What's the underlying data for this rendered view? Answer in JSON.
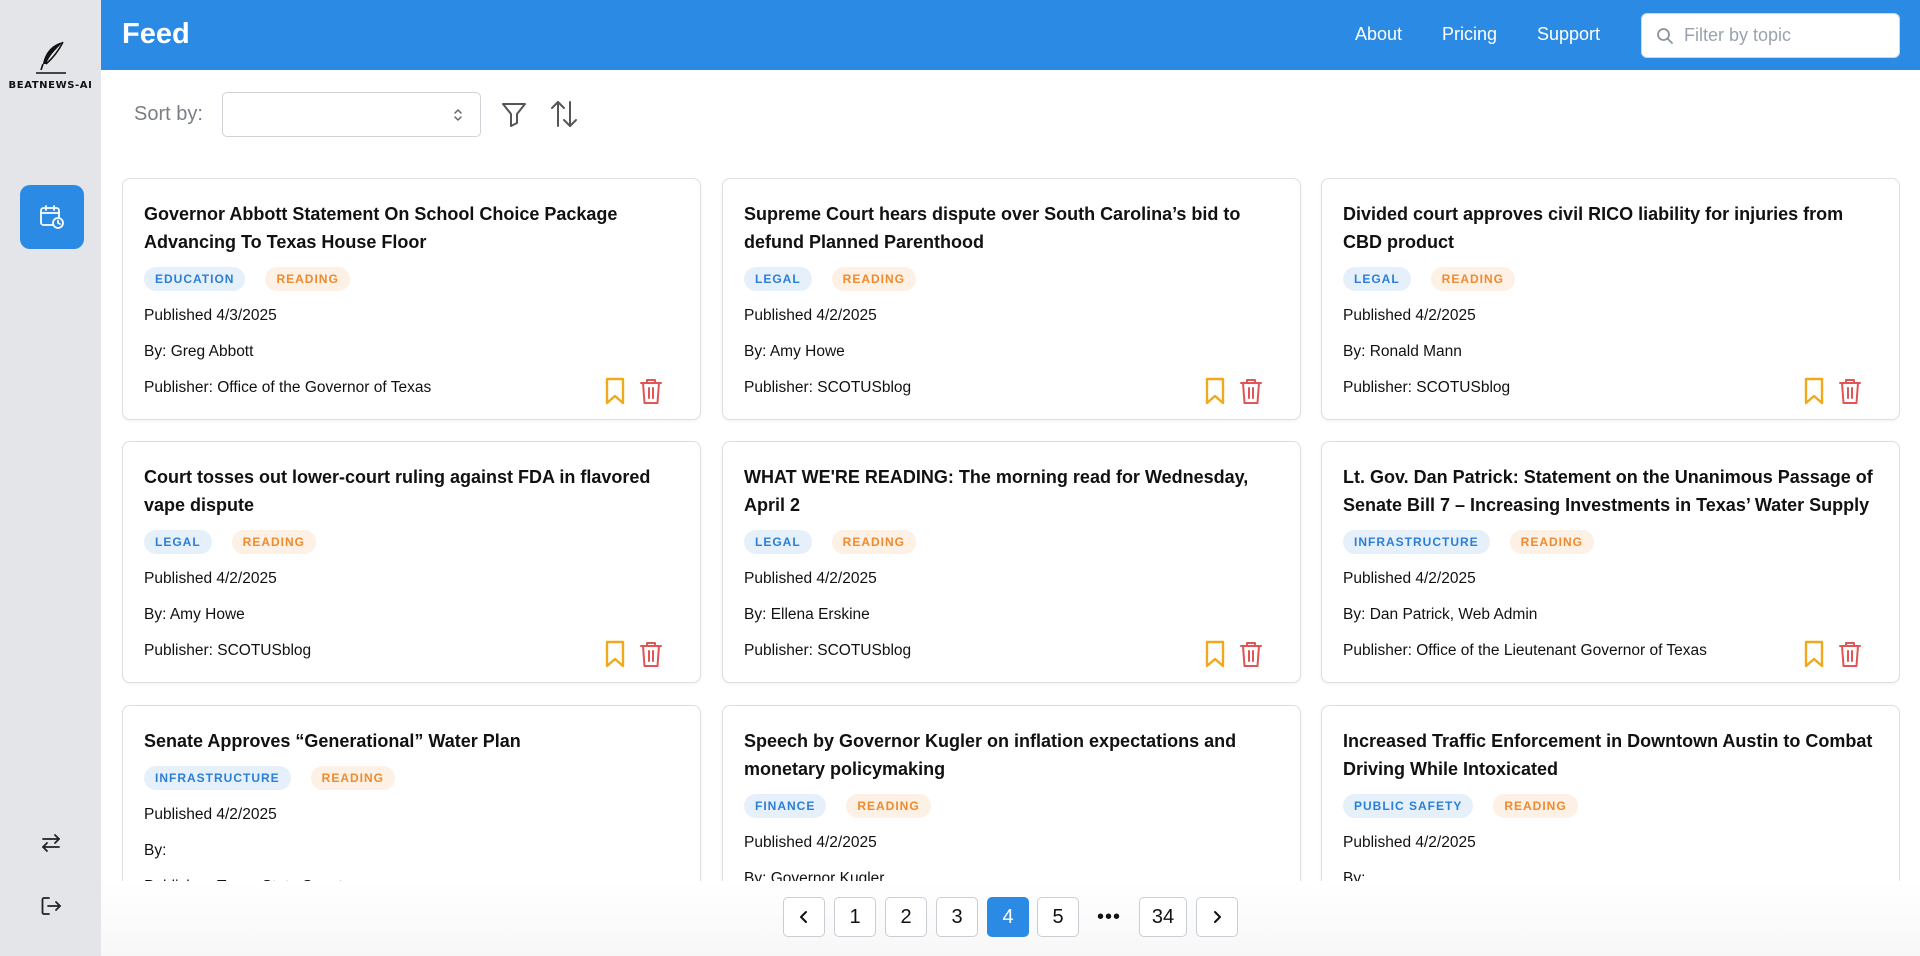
{
  "app": {
    "logo_text": "BEATNEWS-AI",
    "title": "Feed"
  },
  "nav": [
    {
      "label": "About"
    },
    {
      "label": "Pricing"
    },
    {
      "label": "Support"
    }
  ],
  "search": {
    "placeholder": "Filter by topic",
    "value": ""
  },
  "toolbar": {
    "sort_label": "Sort by:",
    "sort_value": ""
  },
  "colors": {
    "accent": "#2b8ae3",
    "bookmark": "#f0a91c",
    "delete": "#e05555",
    "tag_category": "#2b7fd4",
    "tag_reading": "#ef8a2e"
  },
  "icons": {
    "logo": "quill-icon",
    "sidebar_feed": "calendar-clock-icon",
    "sidebar_switch": "swap-arrows-icon",
    "sidebar_logout": "logout-icon",
    "search": "search-icon",
    "filter": "filter-icon",
    "sort": "sort-arrows-icon",
    "bookmark": "bookmark-icon",
    "delete": "trash-icon"
  },
  "cards": [
    {
      "title": "Governor Abbott Statement On School Choice Package Advancing To Texas House Floor",
      "category": "EDUCATION",
      "status": "READING",
      "published": "Published 4/3/2025",
      "by": "By: Greg Abbott",
      "publisher": "Publisher: Office of the Governor of Texas"
    },
    {
      "title": "Supreme Court hears dispute over South Carolina’s bid to defund Planned Parenthood",
      "category": "LEGAL",
      "status": "READING",
      "published": "Published 4/2/2025",
      "by": "By: Amy Howe",
      "publisher": "Publisher: SCOTUSblog"
    },
    {
      "title": "Divided court approves civil RICO liability for injuries from CBD product",
      "category": "LEGAL",
      "status": "READING",
      "published": "Published 4/2/2025",
      "by": "By: Ronald Mann",
      "publisher": "Publisher: SCOTUSblog"
    },
    {
      "title": "Court tosses out lower-court ruling against FDA in flavored vape dispute",
      "category": "LEGAL",
      "status": "READING",
      "published": "Published 4/2/2025",
      "by": "By: Amy Howe",
      "publisher": "Publisher: SCOTUSblog"
    },
    {
      "title": "WHAT WE'RE READING: The morning read for Wednesday, April 2",
      "category": "LEGAL",
      "status": "READING",
      "published": "Published 4/2/2025",
      "by": "By: Ellena Erskine",
      "publisher": "Publisher: SCOTUSblog"
    },
    {
      "title": "Lt. Gov. Dan Patrick: Statement on the Unanimous Passage of Senate Bill 7 – Increasing Investments in Texas’ Water Supply",
      "category": "INFRASTRUCTURE",
      "status": "READING",
      "published": "Published 4/2/2025",
      "by": "By: Dan Patrick, Web Admin",
      "publisher": "Publisher: Office of the Lieutenant Governor of Texas"
    },
    {
      "title": "Senate Approves “Generational” Water Plan",
      "category": "INFRASTRUCTURE",
      "status": "READING",
      "published": "Published 4/2/2025",
      "by": "By:",
      "publisher": "Publisher: Texas State Senate"
    },
    {
      "title": "Speech by Governor Kugler on inflation expectations and monetary policymaking",
      "category": "FINANCE",
      "status": "READING",
      "published": "Published 4/2/2025",
      "by": "By: Governor Kugler",
      "publisher": ""
    },
    {
      "title": "Increased Traffic Enforcement in Downtown Austin to Combat Driving While Intoxicated",
      "category": "PUBLIC SAFETY",
      "status": "READING",
      "published": "Published 4/2/2025",
      "by": "By:",
      "publisher": ""
    }
  ],
  "pagination": {
    "pages": [
      "1",
      "2",
      "3",
      "4",
      "5"
    ],
    "current": "4",
    "ellipsis": "•••",
    "last": "34"
  }
}
